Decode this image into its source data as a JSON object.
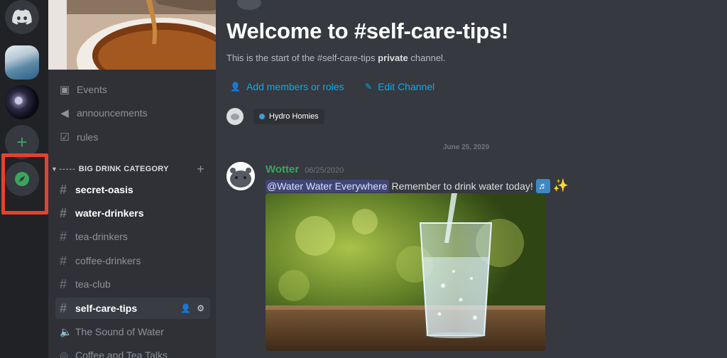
{
  "servers": [
    {
      "icon": "discord-logo-icon"
    },
    {
      "icon": "water-server-icon"
    },
    {
      "icon": "night-sky-server-icon"
    },
    {
      "icon": "add-server-icon",
      "glyph": "+"
    },
    {
      "icon": "explore-compass-icon"
    }
  ],
  "sidebar": {
    "top_items": [
      {
        "icon": "calendar-icon",
        "label": "Events"
      },
      {
        "icon": "megaphone-icon",
        "label": "announcements"
      },
      {
        "icon": "rules-check-icon",
        "label": "rules"
      }
    ],
    "category": {
      "label": "BIG DRINK CATEGORY",
      "add_glyph": "+"
    },
    "channels": [
      {
        "label": "secret-oasis",
        "state": "unread"
      },
      {
        "label": "water-drinkers",
        "state": "unread"
      },
      {
        "label": "tea-drinkers",
        "state": "normal"
      },
      {
        "label": "coffee-drinkers",
        "state": "normal"
      },
      {
        "label": "tea-club",
        "state": "normal"
      },
      {
        "label": "self-care-tips",
        "state": "selected"
      },
      {
        "label": "The Sound of Water",
        "state": "voice"
      },
      {
        "label": "Coffee and Tea Talks",
        "state": "stage"
      }
    ]
  },
  "main": {
    "welcome_title": "Welcome to #self-care-tips!",
    "desc_prefix": "This is the start of the #self-care-tips ",
    "desc_bold": "private",
    "desc_suffix": " channel.",
    "add_members_label": "Add members or roles",
    "edit_channel_label": "Edit Channel",
    "role_pill_label": "Hydro Homies",
    "date_divider": "June 25, 2020",
    "message": {
      "author": "Wotter",
      "timestamp": "06/25/2020",
      "mention": "@Water Water Everywhere",
      "text": "Remember to drink water today!",
      "emoji_1_glyph": "♬",
      "emoji_2_glyph": "✨"
    }
  },
  "colors": {
    "highlight": "#e8412c",
    "link": "#00aff4",
    "author": "#3ba55d",
    "add_green": "#3ba55d"
  }
}
